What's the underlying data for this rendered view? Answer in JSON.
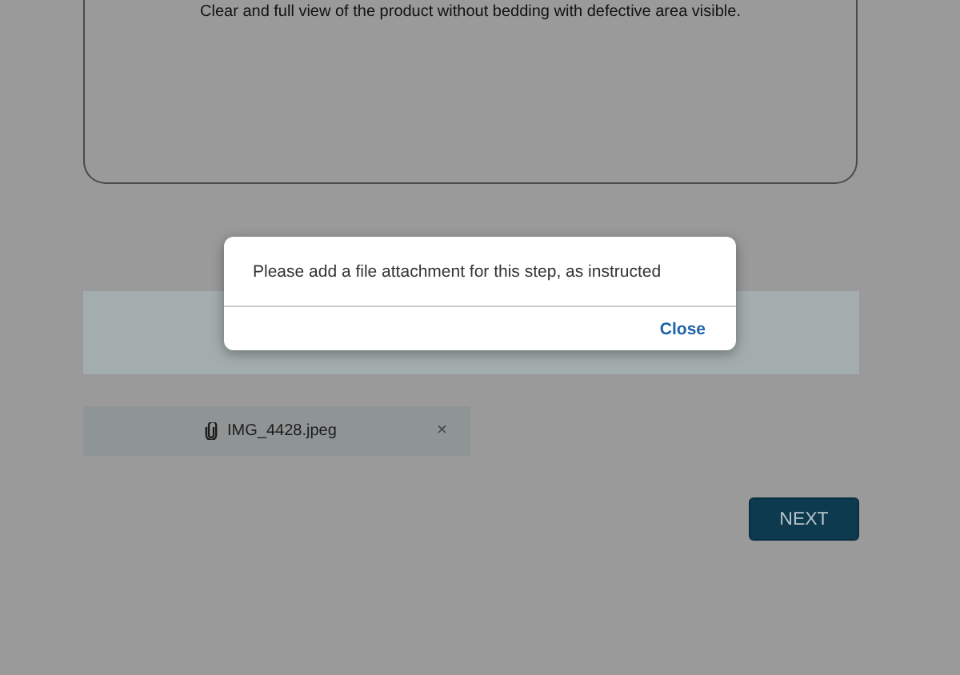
{
  "instruction_panel": {
    "text": "Clear and full view of the product without bedding with defective area visible."
  },
  "attachments": [
    {
      "file_name": "IMG_4428.jpeg",
      "remove": "×"
    }
  ],
  "next_button": {
    "label": "NEXT"
  },
  "dialog": {
    "message": "Please add a file attachment for this step, as instructed",
    "button": "Close"
  }
}
